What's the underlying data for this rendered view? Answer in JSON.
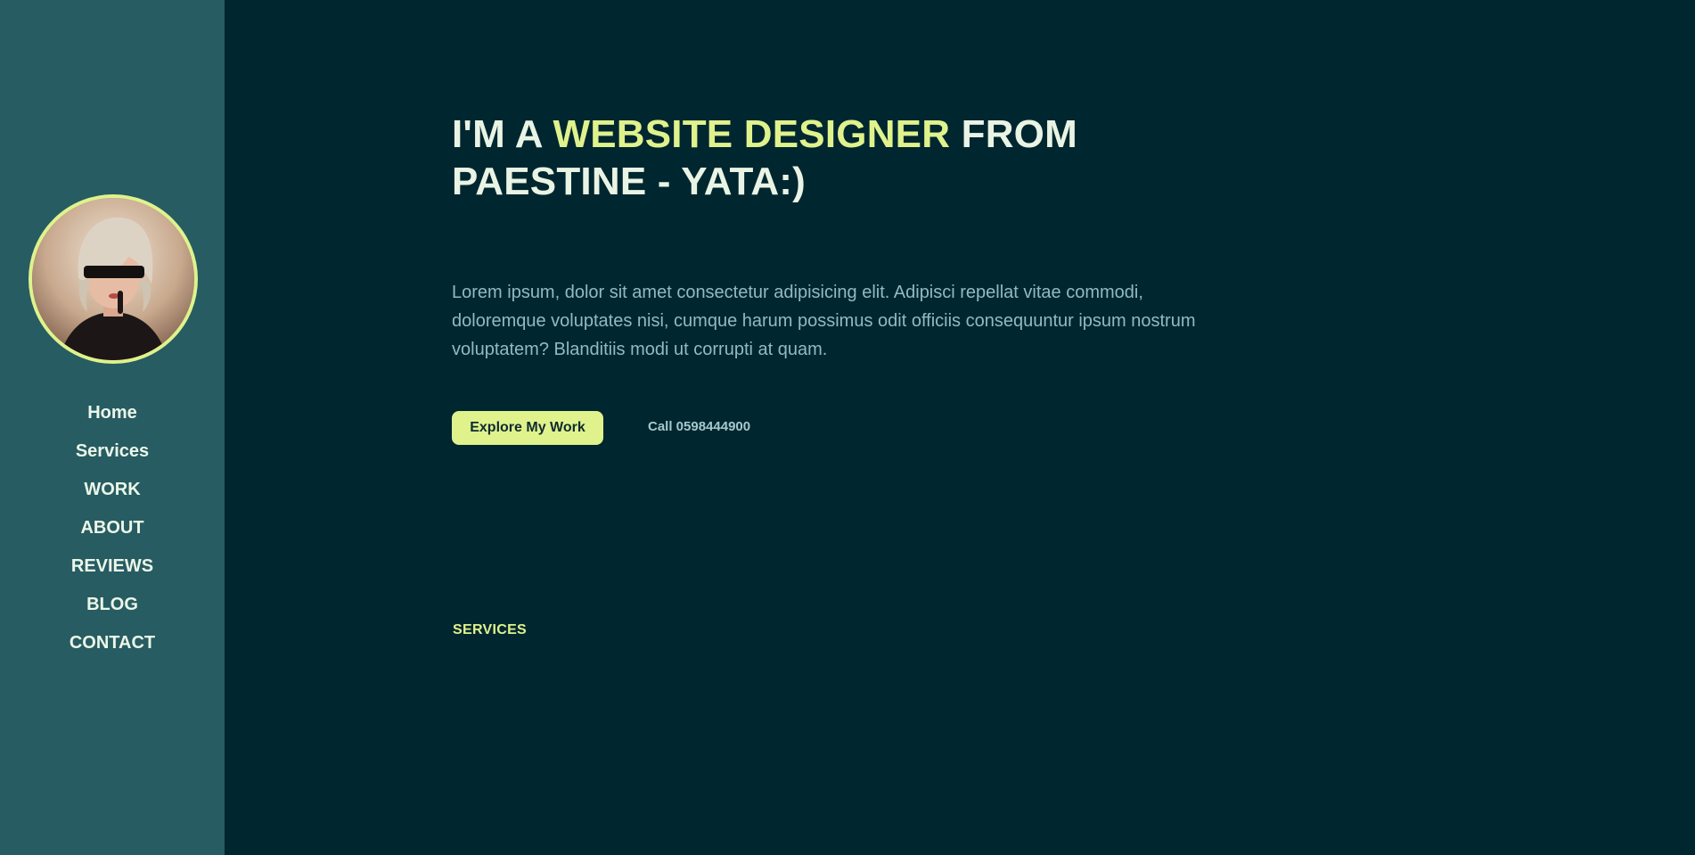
{
  "sidebar": {
    "avatar_icon": "avatar-portrait",
    "nav": [
      {
        "label": "Home"
      },
      {
        "label": "Services"
      },
      {
        "label": "WORK"
      },
      {
        "label": "ABOUT"
      },
      {
        "label": "REVIEWS"
      },
      {
        "label": "BLOG"
      },
      {
        "label": "CONTACT"
      }
    ]
  },
  "hero": {
    "title_prefix": "I'M A ",
    "title_highlight": "WEBSITE DESIGNER",
    "title_suffix": " FROM PAESTINE - YATA:)",
    "intro": "Lorem ipsum, dolor sit amet consectetur adipisicing elit. Adipisci repellat vitae commodi, doloremque voluptates nisi, cumque harum possimus odit officiis consequuntur ipsum nostrum voluptatem? Blanditiis modi ut corrupti at quam.",
    "explore_button": "Explore My Work",
    "call_link": "Call 0598444900"
  },
  "services": {
    "label": "SERVICES"
  },
  "colors": {
    "sidebar_bg": "#265c62",
    "main_bg": "#002630",
    "accent": "#dff28c",
    "heading": "#e9f4e4",
    "body_text": "#8fbcc0"
  }
}
